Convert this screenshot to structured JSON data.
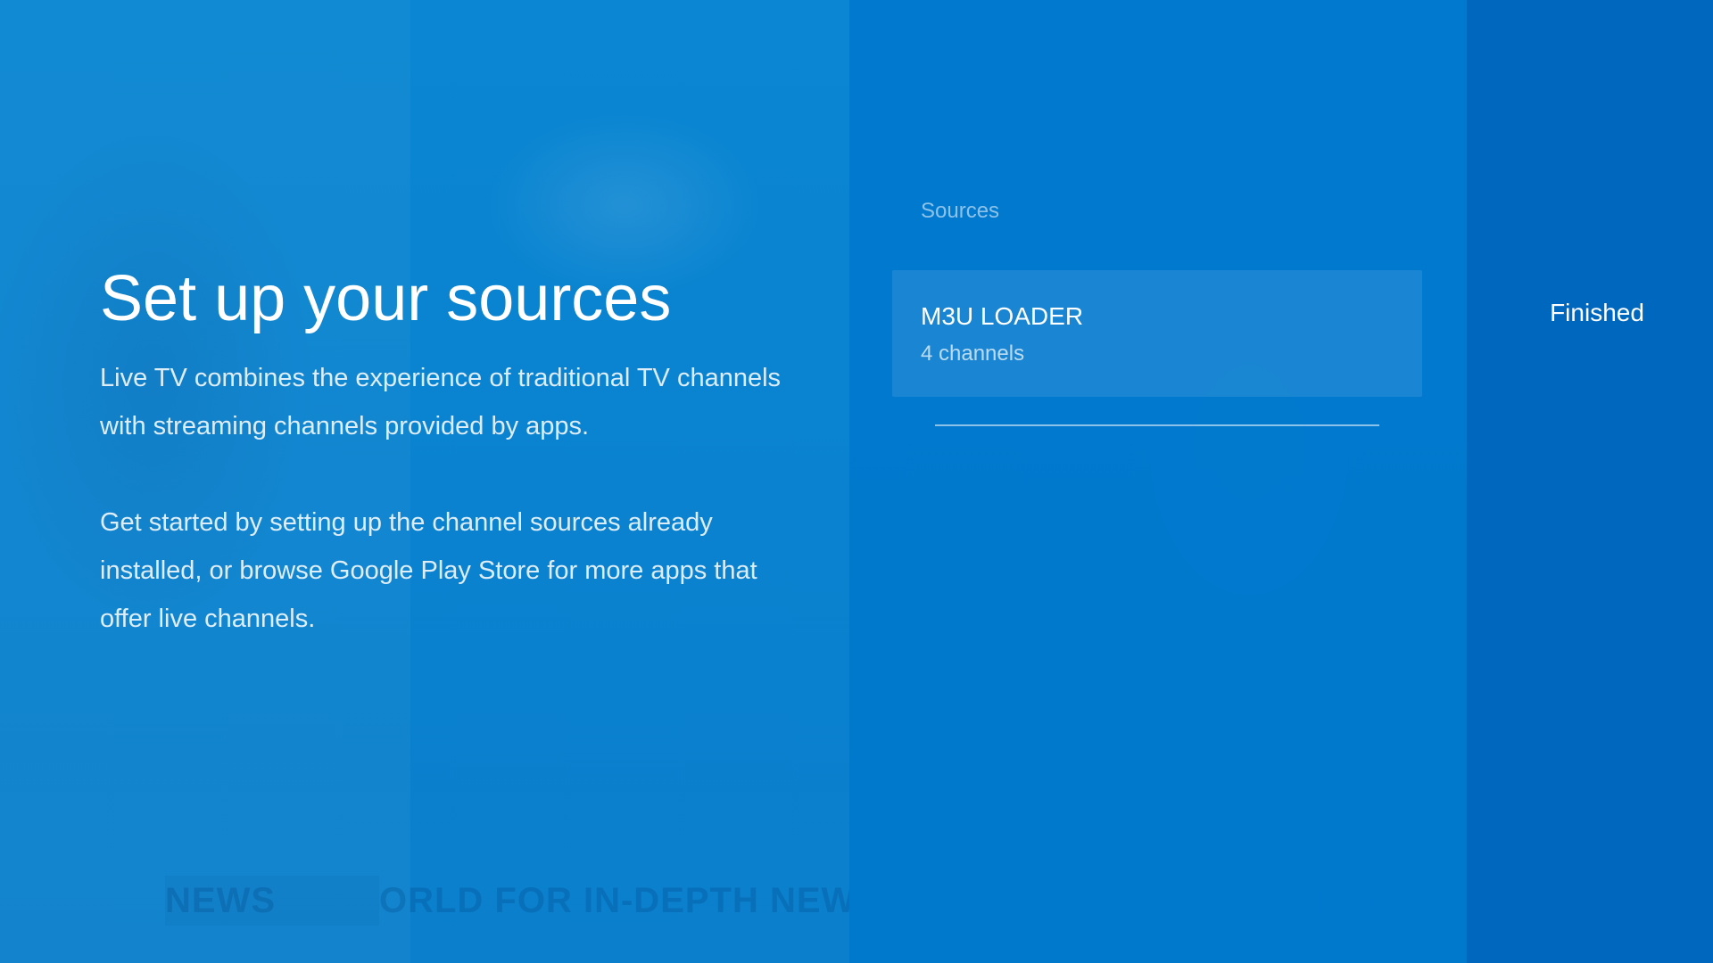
{
  "background": {
    "ticker_badge": "NEWS",
    "ticker_text": "ORLD FOR IN-DEPTH NEWS COVERAGE  ·  DELEGATIONS FROM SW"
  },
  "main": {
    "title": "Set up your sources",
    "paragraphs": [
      "Live TV combines the experience of traditional TV channels with streaming channels provided by apps.",
      "Get started by setting up the channel sources already installed, or browse Google Play Store for more apps that offer live channels."
    ]
  },
  "sources": {
    "section_label": "Sources",
    "items": [
      {
        "name": "M3U LOADER",
        "detail": "4 channels"
      }
    ]
  },
  "actions": {
    "finished_label": "Finished"
  },
  "colors": {
    "background": "#0a82cf",
    "middle_panel": "#0078cd",
    "right_panel": "#0067bf",
    "text_primary": "#ffffff"
  }
}
